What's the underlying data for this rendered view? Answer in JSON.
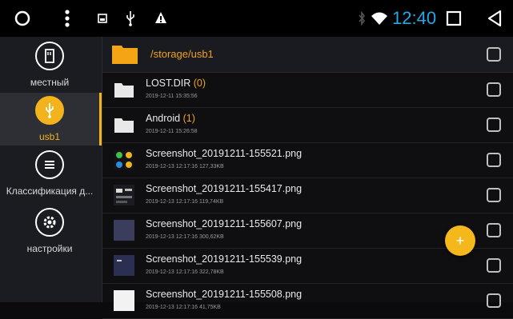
{
  "statusbar": {
    "time": "12:40",
    "time_color": "#27a7e8",
    "icons": [
      "circle-home-icon",
      "more-vert-icon",
      "sd-card-icon",
      "usb-icon",
      "alert-icon",
      "bluetooth-icon",
      "wifi-icon",
      "recents-square-icon",
      "back-triangle-icon"
    ]
  },
  "sidebar": {
    "items": [
      {
        "label": "местный",
        "icon": "sd-card-icon"
      },
      {
        "label": "usb1",
        "icon": "usb-icon",
        "active": true
      },
      {
        "label": "Классификация д...",
        "icon": "list-icon"
      },
      {
        "label": "настройки",
        "icon": "settings-gear-icon"
      }
    ],
    "accent_color": "#f2b31c"
  },
  "path": {
    "text": "/storage/usb1",
    "color": "#f0a21a"
  },
  "files": [
    {
      "name": "LOST.DIR",
      "count": "(0)",
      "meta": "2019-12-11 15:35:56",
      "type": "folder"
    },
    {
      "name": "Android",
      "count": "(1)",
      "meta": "2019-12-11 15:26:58",
      "type": "folder"
    },
    {
      "name": "Screenshot_20191211-155521.png",
      "count": "",
      "meta": "2019-12-13 12:17:16   127,33KB",
      "type": "image"
    },
    {
      "name": "Screenshot_20191211-155417.png",
      "count": "",
      "meta": "2019-12-13 12:17:16   119,74KB",
      "type": "image"
    },
    {
      "name": "Screenshot_20191211-155607.png",
      "count": "",
      "meta": "2019-12-13 12:17:16   300,62KB",
      "type": "image"
    },
    {
      "name": "Screenshot_20191211-155539.png",
      "count": "",
      "meta": "2019-12-13 12:17:16   322,78KB",
      "type": "image"
    },
    {
      "name": "Screenshot_20191211-155508.png",
      "count": "",
      "meta": "2019-12-13 12:17:16   41,75KB",
      "type": "image"
    }
  ],
  "fab": {
    "label": "+",
    "color": "#f5b81c"
  }
}
